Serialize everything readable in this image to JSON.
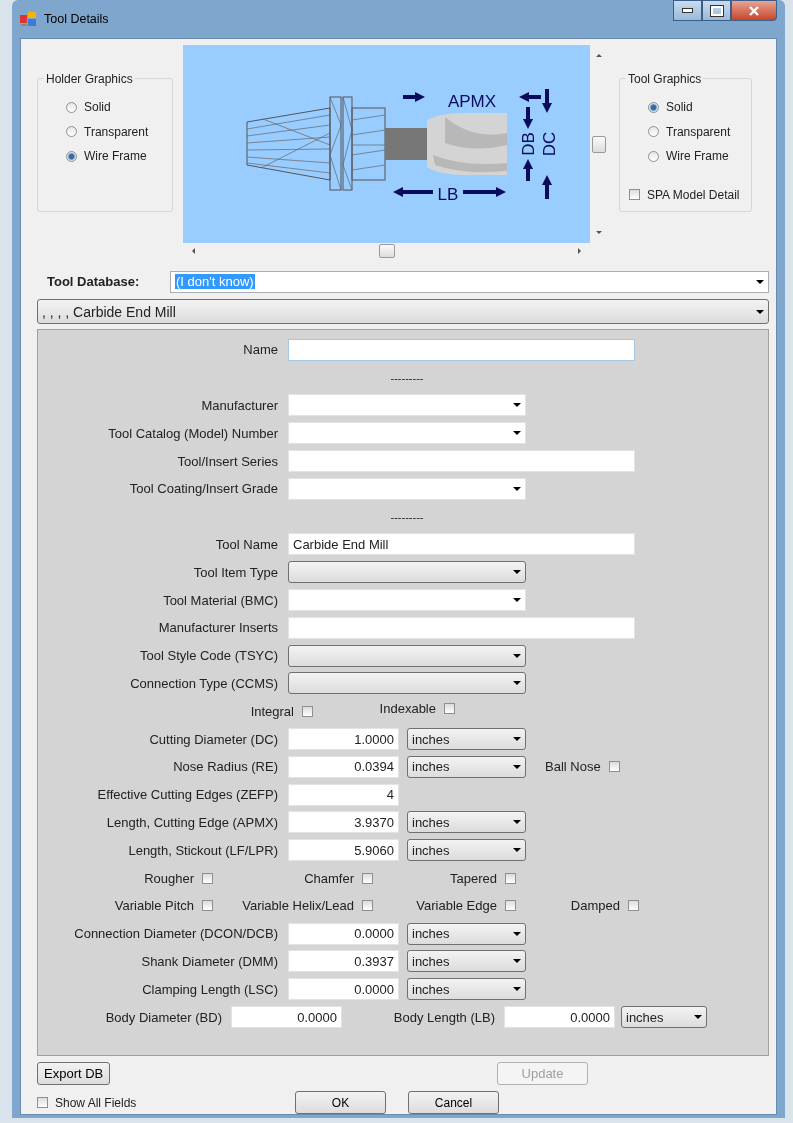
{
  "window": {
    "title": "Tool Details"
  },
  "holder_graphics": {
    "title": "Holder Graphics",
    "options": [
      {
        "label": "Solid",
        "selected": false
      },
      {
        "label": "Transparent",
        "selected": false
      },
      {
        "label": "Wire Frame",
        "selected": true
      }
    ]
  },
  "preview": {
    "labels": [
      {
        "text": "APMX"
      },
      {
        "text": "LB"
      },
      {
        "text": "DB"
      },
      {
        "text": "DC"
      }
    ]
  },
  "tool_graphics": {
    "title": "Tool Graphics",
    "options": [
      {
        "label": "Solid",
        "selected": true
      },
      {
        "label": "Transparent",
        "selected": false
      },
      {
        "label": "Wire Frame",
        "selected": false
      }
    ],
    "spa_model_detail": {
      "label": "SPA Model Detail",
      "checked": false
    }
  },
  "tool_database": {
    "label": "Tool Database:",
    "value": "(I don't know)"
  },
  "tool_selector": {
    "value": ", , , , Carbide End Mill"
  },
  "rows": [
    {
      "kind": "text",
      "label": "Name"
    },
    {
      "kind": "separator",
      "text": "---------"
    },
    {
      "kind": "combo",
      "label": "Manufacturer",
      "editable": true
    },
    {
      "kind": "combo",
      "label": "Tool Catalog (Model) Number",
      "editable": true
    },
    {
      "kind": "text",
      "label": "Tool/Insert Series"
    },
    {
      "kind": "combo",
      "label": "Tool Coating/Insert Grade",
      "editable": true
    },
    {
      "kind": "separator",
      "text": "---------"
    },
    {
      "kind": "text",
      "label": "Tool Name",
      "value": "Carbide End Mill"
    },
    {
      "kind": "combo",
      "label": "Tool Item Type",
      "editable": false
    },
    {
      "kind": "combo",
      "label": "Tool Material (BMC)",
      "editable": true
    },
    {
      "kind": "text",
      "label": "Manufacturer Inserts"
    },
    {
      "kind": "combo",
      "label": "Tool Style Code (TSYC)",
      "editable": false
    },
    {
      "kind": "combo",
      "label": "Connection Type (CCMS)",
      "editable": false
    },
    {
      "kind": "flag-pair",
      "items": [
        {
          "label": "Integral",
          "checked": false
        },
        {
          "label": "Indexable",
          "checked": false
        }
      ]
    },
    {
      "kind": "measure",
      "label": "Cutting Diameter (DC)",
      "value": "1.0000",
      "unit": "inches"
    },
    {
      "kind": "measure",
      "label": "Nose Radius (RE)",
      "value": "0.0394",
      "unit": "inches",
      "flag": {
        "label": "Ball Nose",
        "checked": false
      }
    },
    {
      "kind": "measure",
      "label": "Effective Cutting Edges (ZEFP)",
      "value": "4"
    },
    {
      "kind": "measure",
      "label": "Length, Cutting Edge (APMX)",
      "value": "3.9370",
      "unit": "inches"
    },
    {
      "kind": "measure",
      "label": "Length, Stickout (LF/LPR)",
      "value": "5.9060",
      "unit": "inches"
    },
    {
      "kind": "flags",
      "items": [
        {
          "label": "Rougher",
          "checked": false
        },
        {
          "label": "Chamfer",
          "checked": false
        },
        {
          "label": "Tapered",
          "checked": false
        }
      ]
    },
    {
      "kind": "flags",
      "items": [
        {
          "label": "Variable Pitch",
          "checked": false
        },
        {
          "label": "Variable Helix/Lead",
          "checked": false
        },
        {
          "label": "Variable Edge",
          "checked": false
        },
        {
          "label": "Damped",
          "checked": false
        }
      ]
    },
    {
      "kind": "measure",
      "label": "Connection Diameter (DCON/DCB)",
      "value": "0.0000",
      "unit": "inches"
    },
    {
      "kind": "measure",
      "label": "Shank Diameter (DMM)",
      "value": "0.3937",
      "unit": "inches"
    },
    {
      "kind": "measure",
      "label": "Clamping Length (LSC)",
      "value": "0.0000",
      "unit": "inches"
    },
    {
      "kind": "body",
      "items": [
        {
          "label": "Body Diameter (BD)",
          "value": "0.0000"
        },
        {
          "label": "Body Length (LB)",
          "value": "0.0000"
        }
      ],
      "unit": "inches"
    }
  ],
  "footer": {
    "export": {
      "label": "Export DB"
    },
    "update": {
      "label": "Update",
      "disabled": true
    },
    "show_all": {
      "label": "Show All Fields",
      "checked": false
    },
    "ok": {
      "label": "OK"
    },
    "cancel": {
      "label": "Cancel"
    }
  }
}
